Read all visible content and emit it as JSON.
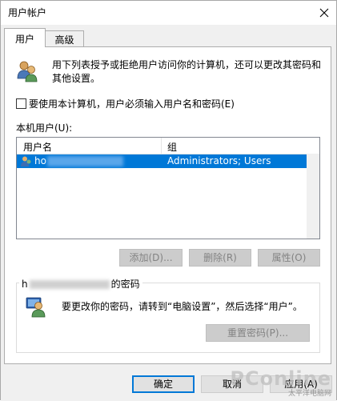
{
  "window": {
    "title": "用户帐户"
  },
  "tabs": [
    {
      "label": "用户"
    },
    {
      "label": "高级"
    }
  ],
  "intro_text": "用下列表授予或拒绝用户访问你的计算机，还可以更改其密码和其他设置。",
  "require_login": {
    "label": "要使用本计算机，用户必须输入用户名和密码(E)",
    "checked": false
  },
  "local_users_label": "本机用户(U):",
  "users_table": {
    "columns": [
      "用户名",
      "组"
    ],
    "rows": [
      {
        "username": "ho",
        "group": "Administrators; Users",
        "selected": true
      }
    ]
  },
  "buttons": {
    "add": "添加(D)...",
    "remove": "删除(R)",
    "properties": "属性(O)",
    "reset_password": "重置密码(P)...",
    "ok": "确定",
    "cancel": "取消",
    "apply": "应用(A)"
  },
  "password_group": {
    "title_prefix": "h",
    "title_suffix": "的密码",
    "text": "要更改你的密码，请转到“电脑设置”，然后选择“用户”。"
  },
  "watermark": {
    "logo": "PConline",
    "sub": "太平洋电脑网"
  },
  "colors": {
    "selection": "#0078d7",
    "window_bg": "#f0f0f0"
  }
}
